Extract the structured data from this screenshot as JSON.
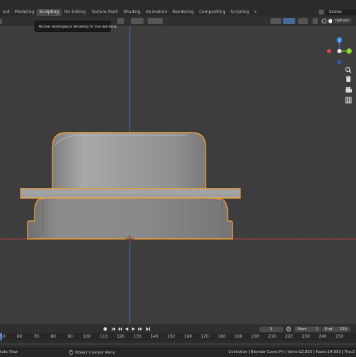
{
  "workspace_tabs": [
    "out",
    "Modeling",
    "Sculpting",
    "UV Editing",
    "Texture Paint",
    "Shading",
    "Animation",
    "Rendering",
    "Compositing",
    "Scripting"
  ],
  "active_tab_index": 2,
  "add_workspace_label": "+",
  "scene_name": "Scene",
  "tooltip": "Active workspace showing in the window.",
  "header": {
    "options_label": "Options"
  },
  "gizmo": {
    "z_label": "Z",
    "y_label": "Y"
  },
  "timeline": {
    "current_frame": "1",
    "start_label": "Start",
    "start_value": "1",
    "end_label": "End",
    "end_value": "250",
    "ruler_ticks": [
      "50",
      "60",
      "70",
      "80",
      "90",
      "100",
      "110",
      "120",
      "130",
      "140",
      "150",
      "160",
      "170",
      "180",
      "190",
      "200",
      "210",
      "220",
      "230",
      "240",
      "250"
    ]
  },
  "status": {
    "left": "tate View",
    "middle": "Object Context Menu",
    "right": "Collection | Blender Cover.Prt | Verts:12,855 | Faces:14,655 | Tris:2"
  },
  "colors": {
    "background": "#3d3d3d",
    "selection_outline": "#f29c38",
    "x_axis": "#b5414b",
    "y_axis_vertical": "#3f6fae",
    "gizmo_x": "#e0424f",
    "gizmo_y": "#7cc81a",
    "gizmo_z": "#3b8cf0",
    "active_tab": "#4a4a4a"
  }
}
